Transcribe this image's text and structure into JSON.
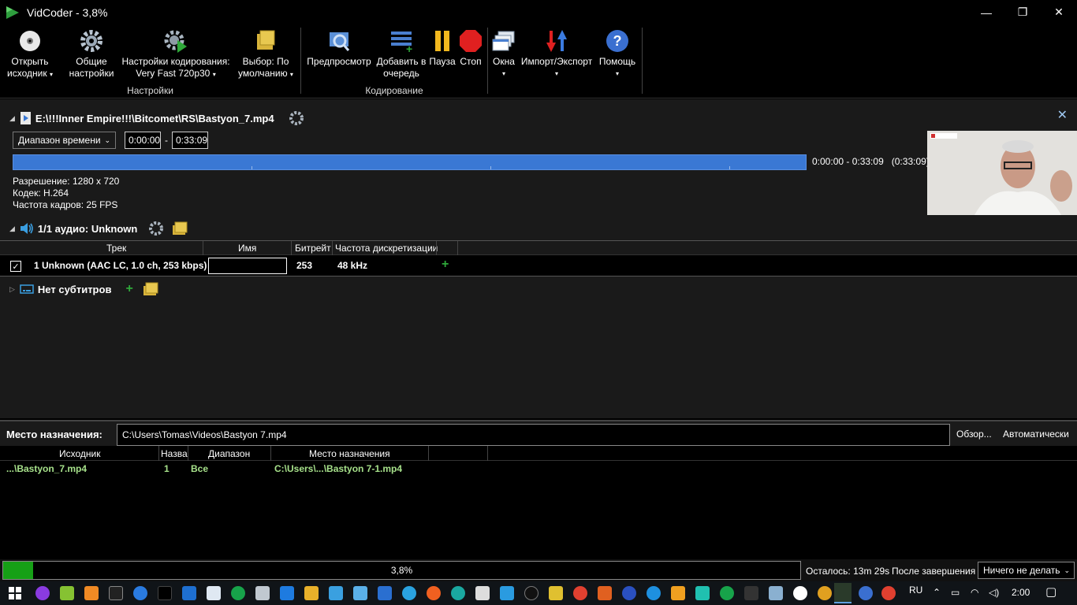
{
  "window": {
    "title": "VidCoder - 3,8%",
    "controls": {
      "minimize": "—",
      "restore": "❐",
      "close": "✕"
    }
  },
  "ribbon": {
    "open_source": {
      "line1": "Открыть",
      "line2": "исходник"
    },
    "general_settings": {
      "line1": "Общие",
      "line2": "настройки"
    },
    "encoding_settings": {
      "line1": "Настройки кодирования:",
      "line2": "Very Fast 720p30"
    },
    "picker": {
      "line1": "Выбор: По",
      "line2": "умолчанию"
    },
    "group_settings": "Настройки",
    "preview": "Предпросмотр",
    "add_queue": {
      "line1": "Добавить в",
      "line2": "очередь"
    },
    "pause": "Пауза",
    "stop": "Стоп",
    "group_encoding": "Кодирование",
    "windows": "Окна",
    "import_export": "Импорт/Экспорт",
    "help": "Помощь"
  },
  "source": {
    "path": "E:\\!!!Inner Empire!!!\\Bitcomet\\RS\\Bastyon_7.mp4",
    "range_mode": "Диапазон времени",
    "start": "0:00:00",
    "dash": "-",
    "end": "0:33:09",
    "range_text": "0:00:00 - 0:33:09",
    "duration_text": "(0:33:09)",
    "resolution": "Разрешение: 1280 x 720",
    "codec": "Кодек: H.264",
    "fps": "Частота кадров: 25  FPS"
  },
  "audio": {
    "header": "1/1 аудио: Unknown",
    "columns": [
      "Трек",
      "Имя",
      "Битрейт",
      "Частота дискретизации"
    ],
    "row": {
      "track": "1 Unknown (AAC LC, 1.0 ch, 253 kbps)",
      "name": "",
      "bitrate": "253",
      "samplerate": "48 kHz",
      "checked": "✓"
    }
  },
  "subtitles": {
    "header": "Нет субтитров"
  },
  "destination": {
    "label": "Место назначения:",
    "path": "C:\\Users\\Tomas\\Videos\\Bastyon 7.mp4",
    "browse": "Обзор...",
    "auto": "Автоматически"
  },
  "queue": {
    "columns": [
      "Исходник",
      "Назва",
      "Диапазон",
      "Место назначения"
    ],
    "rows": [
      {
        "source": "...\\Bastyon_7.mp4",
        "title": "1",
        "range": "Все",
        "dest": "C:\\Users\\...\\Bastyon 7-1.mp4"
      }
    ]
  },
  "status": {
    "progress_fraction": 0.038,
    "progress_text": "3,8%",
    "remaining": "Осталось: 13m 29s",
    "after_label": "После завершения",
    "after_value": "Ничего не делать"
  },
  "taskbar": {
    "lang": "RU",
    "time": "2:00"
  },
  "colors": {
    "accent_blue": "#3a78d4",
    "progress_green": "#16a016",
    "queue_text": "#a6e08a"
  }
}
